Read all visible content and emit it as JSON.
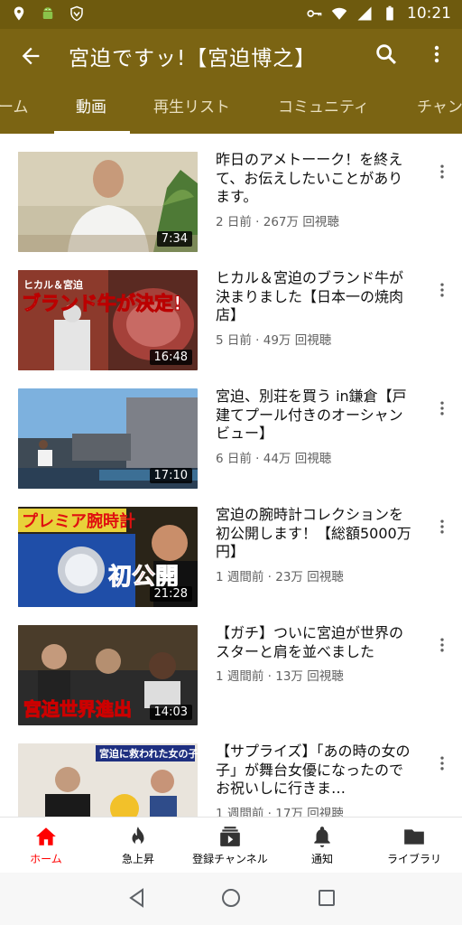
{
  "status": {
    "time": "10:21"
  },
  "appbar": {
    "title": "宮迫ですッ!【宮迫博之】"
  },
  "tabs": [
    {
      "label": "ーム"
    },
    {
      "label": "動画"
    },
    {
      "label": "再生リスト"
    },
    {
      "label": "コミュニティ"
    },
    {
      "label": "チャン"
    }
  ],
  "videos": [
    {
      "title": "昨日のアメトーーク！を終えて、お伝えしたいことがあります。",
      "meta": "2 日前 · 267万 回視聴",
      "duration": "7:34"
    },
    {
      "title": "ヒカル＆宮迫のブランド牛が決まりました【日本一の焼肉店】",
      "meta": "5 日前 · 49万 回視聴",
      "duration": "16:48"
    },
    {
      "title": "宮迫、別荘を買う in鎌倉【戸建てプール付きのオーシャンビュー】",
      "meta": "6 日前 · 44万 回視聴",
      "duration": "17:10"
    },
    {
      "title": "宮迫の腕時計コレクションを初公開します！【総額5000万円】",
      "meta": "1 週間前 · 23万 回視聴",
      "duration": "21:28"
    },
    {
      "title": "【ガチ】ついに宮迫が世界のスターと肩を並べました",
      "meta": "1 週間前 · 13万 回視聴",
      "duration": "14:03"
    },
    {
      "title": "【サプライズ】「あの時の女の子」が舞台女優になったのでお祝いしに行きま…",
      "meta": "1 週間前 · 17万 回視聴",
      "duration": ""
    }
  ],
  "thumb_text": {
    "t2_top": "ヒカル＆宮迫",
    "t2_main": "ブランド牛が決定!",
    "t4_top": "プレミア腕時計",
    "t4_main": "初公開",
    "t5_main": "宮迫世界進出",
    "t6_top": "宮迫に救われた女の子"
  },
  "bottom_nav": [
    {
      "label": "ホーム"
    },
    {
      "label": "急上昇"
    },
    {
      "label": "登録チャンネル"
    },
    {
      "label": "通知"
    },
    {
      "label": "ライブラリ"
    }
  ],
  "colors": {
    "header_bg": "#7b6413",
    "statusbar_bg": "#6e5a0e",
    "active_red": "#ff0000"
  }
}
